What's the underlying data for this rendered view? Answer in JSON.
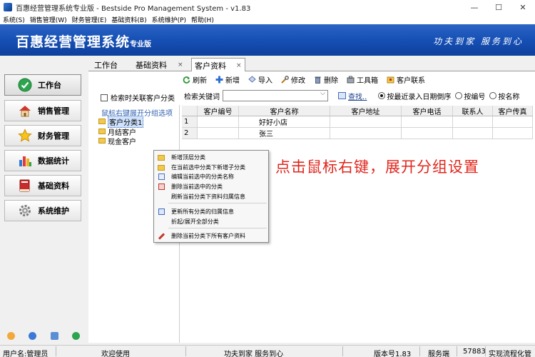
{
  "window": {
    "title": "百惠经营管理系统专业版 - Bestside Pro Management System - v1.83",
    "minimize": "—",
    "maximize": "☐",
    "close": "✕"
  },
  "menubar": [
    "系统(S)",
    "销售管理(W)",
    "财务管理(E)",
    "基础资料(B)",
    "系统维护(P)",
    "帮助(H)"
  ],
  "banner": {
    "title": "百惠经营管理系统",
    "edition": "专业版",
    "slogan": "功夫到家 服务到心"
  },
  "nav": [
    {
      "label": "工作台",
      "icon": "check-circle-icon"
    },
    {
      "label": "销售管理",
      "icon": "house-icon"
    },
    {
      "label": "财务管理",
      "icon": "star-icon"
    },
    {
      "label": "数据统计",
      "icon": "bar-chart-icon"
    },
    {
      "label": "基础资料",
      "icon": "book-icon"
    },
    {
      "label": "系统维护",
      "icon": "gear-icon"
    }
  ],
  "tabs": [
    {
      "label": "工作台"
    },
    {
      "label": "基础资料",
      "close": "×"
    },
    {
      "label": "客户资料",
      "close": "×"
    }
  ],
  "toolbar": [
    "刷新",
    "新增",
    "导入",
    "修改",
    "删除",
    "工具箱",
    "客户联系"
  ],
  "left_option": "检索时关联客户分类",
  "search": {
    "label": "检索关键词",
    "value": "",
    "find": "查找..",
    "sort_options": [
      "按最近录入日期倒序",
      "按编号",
      "按名称"
    ],
    "selected": "按最近录入日期倒序"
  },
  "tree": {
    "hint": "鼠标右键展开分组选项",
    "items": [
      "客户分类1",
      "月结客户",
      "现金客户"
    ]
  },
  "grid": {
    "columns": [
      "",
      "客户编号",
      "客户名称",
      "客户地址",
      "客户电话",
      "联系人",
      "客户传真"
    ],
    "rows": [
      {
        "num": "1",
        "name": "好好小店"
      },
      {
        "num": "2",
        "name": "张三"
      }
    ]
  },
  "context_menu": [
    "新增顶层分类",
    "在当前选中分类下新增子分类",
    "编辑当前选中的分类名称",
    "删除当前选中的分类",
    "刷新当前分类下资料归属信息",
    "更新所有分类的归属信息",
    "折起/展开全部分类",
    "删除当前分类下所有客户资料"
  ],
  "annotation": "点击鼠标右键，展开分组设置",
  "status": {
    "user": "用户名:管理员",
    "welcome": "欢迎使用",
    "motto": "功夫到家 服务到心",
    "version": "版本号1.83",
    "server": "服务端",
    "port": "57883",
    "flow": "实现流程化管"
  }
}
